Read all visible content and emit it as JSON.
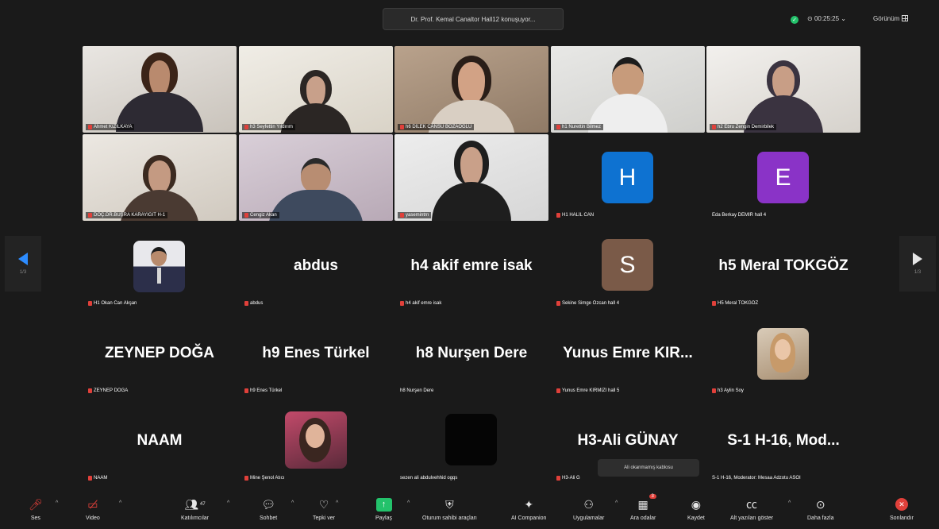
{
  "topbar": {
    "speaking": "Dr. Prof. Kemal Canaltor Hall12 konuşuyor...",
    "timer": "00:25:25",
    "view_label": "Görünüm"
  },
  "nav": {
    "left_page": "1/3",
    "right_page": "1/3"
  },
  "tiles": {
    "r1c1": "Ahmet KIZILKAYA",
    "r1c2": "h3 Seyfettin Yıldırım",
    "r1c3": "h6 DİLEK CANSU BOZAOĞLU",
    "r1c4": "h1 Nurettin Bilmez",
    "r1c5": "h2 Ebru Zengin Demirbilek",
    "r2c1": "DOÇ.DR.BUŞRA KARAYIĞIT H-1",
    "r2c2": "Cengiz Akan",
    "r2c3": "yasemintrn",
    "r2c4": "H1 HALİL CAN",
    "r2c4_letter": "H",
    "r2c5": "Eda Berkay DEMİR hall 4",
    "r2c5_letter": "E",
    "r3c1": "H1 Okan Can Akşan",
    "r3c2_big": "abdus",
    "r3c2": "abdus",
    "r3c3_big": "h4 akif emre isak",
    "r3c3": "h4 akif emre isak",
    "r3c4_letter": "S",
    "r3c4": "Sekine Simge Özcan hall 4",
    "r3c5_big": "h5 Meral TOKGÖZ",
    "r3c5": "H5 Meral TOKGÖZ",
    "r4c1_big": "ZEYNEP DOĞA",
    "r4c1": "ZEYNEP DOĞA",
    "r4c2_big": "h9 Enes Türkel",
    "r4c2": "h9 Enes Türkel",
    "r4c3_big": "h8 Nurşen Dere",
    "r4c3": "h8 Nurşen Dere",
    "r4c4_big": "Yunus Emre KIR...",
    "r4c4": "Yunus Emre KIRMIZI hall 5",
    "r4c5": "h3 Aylin Soy",
    "r5c1_big": "NAAM",
    "r5c1": "NAAM",
    "r5c2": "Mine Şenol Atıcı",
    "r5c3": "sezen ali abdulvehhid ogqs",
    "r5c4_big": "H3-Ali GÜNAY",
    "r5c4": "H3-Ali G",
    "r5c5_big": "S-1   H-16, Mod...",
    "r5c5": "S-1   H-16, Moderator: Mesaa Adzotu ASOI"
  },
  "tooltip": "Ali okanmamış kablosu",
  "toolbar": {
    "audio": "Ses",
    "video": "Video",
    "participants": "Katılımcılar",
    "participants_count": "47",
    "chat": "Sohbet",
    "react": "Tepki ver",
    "share": "Paylaş",
    "host_tools": "Oturum sahibi araçları",
    "ai": "AI Companion",
    "apps": "Uygulamalar",
    "breakout": "Ara odalar",
    "breakout_badge": "3",
    "record": "Kaydet",
    "captions": "Alt yazıları göster",
    "more": "Daha fazla",
    "end": "Sonlandır"
  },
  "colors": {
    "accent_blue": "#2d8cff",
    "avatar_h": "#0e72d1",
    "avatar_e": "#8a33c7",
    "avatar_s": "#7a5a48",
    "share_green": "#23c26b",
    "end_red": "#e0403a"
  }
}
